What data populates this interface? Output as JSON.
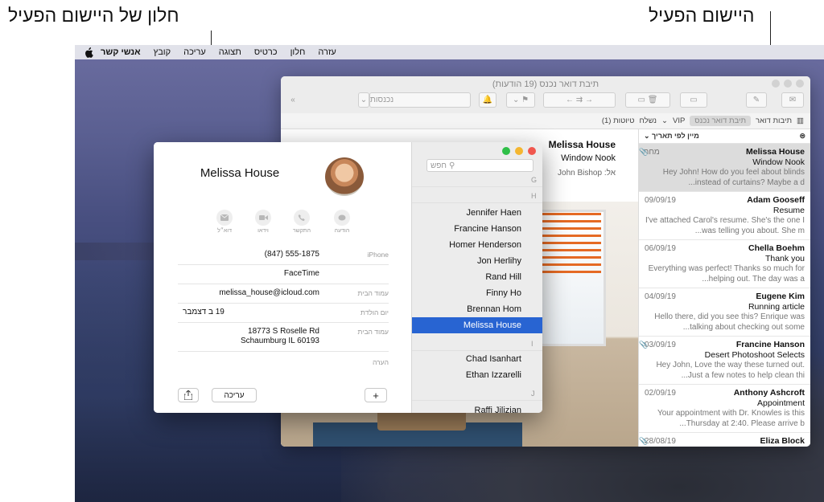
{
  "callouts": {
    "active_window": "חלון של היישום הפעיל",
    "active_app": "היישום הפעיל"
  },
  "menubar": {
    "items": [
      "אנשי קשר",
      "קובץ",
      "עריכה",
      "תצוגה",
      "כרטיס",
      "חלון",
      "עזרה"
    ]
  },
  "mail": {
    "title": "תיבת דואר נכנס (19 הודעות)",
    "search_placeholder": "נכנסות",
    "favorites": {
      "mailboxes": "תיבות דואר",
      "inbox": "תיבת דואר נכנס",
      "vip": "VIP",
      "sent": "נשלח",
      "drafts": "טיוטות (1)"
    },
    "sort_label": "מיין לפי תאריך",
    "open_message": {
      "from": "Melissa House",
      "subject": "Window Nook",
      "to_label": "אל:",
      "to": "John Bishop"
    },
    "messages": [
      {
        "from": "Melissa House",
        "date": "מחר",
        "subject": "Window Nook",
        "preview": "Hey John! How do you feel about blinds instead of curtains? Maybe a d...",
        "clip": true
      },
      {
        "from": "Adam Gooseff",
        "date": "09/09/19",
        "subject": "Resume",
        "preview": "I've attached Carol's resume. She's the one I was telling you about. She m...",
        "clip": false
      },
      {
        "from": "Chella Boehm",
        "date": "06/09/19",
        "subject": "Thank you",
        "preview": "Everything was perfect! Thanks so much for helping out. The day was a...",
        "clip": false
      },
      {
        "from": "Eugene Kim",
        "date": "04/09/19",
        "subject": "Running article",
        "preview": "Hello there, did you see this? Enrique was talking about checking out some...",
        "clip": false
      },
      {
        "from": "Francine Hanson",
        "date": "03/09/19",
        "subject": "Desert Photoshoot Selects",
        "preview": "Hey John, Love the way these turned out. Just a few notes to help clean thi...",
        "clip": true
      },
      {
        "from": "Anthony Ashcroft",
        "date": "02/09/19",
        "subject": "Appointment",
        "preview": "Your appointment with Dr. Knowles is this Thursday at 2:40. Please arrive b...",
        "clip": false
      },
      {
        "from": "Eliza Block",
        "date": "28/08/19",
        "subject": "",
        "preview": "",
        "clip": true
      }
    ]
  },
  "contacts": {
    "search_placeholder": "חפש",
    "card": {
      "name": "Melissa House",
      "actions": {
        "message": "הודעה",
        "call": "התקשר",
        "video": "וידאו",
        "mail": "דוא״ל"
      },
      "fields": [
        {
          "label": "iPhone",
          "value": "(847) 555-1875"
        },
        {
          "label": "",
          "value": "FaceTime"
        },
        {
          "label": "עמוד הבית",
          "value": "melissa_house@icloud.com"
        },
        {
          "label": "יום הולדת",
          "value": "19 ב דצמבר"
        },
        {
          "label": "עמוד הבית",
          "value": "18773 S Roselle Rd\nSchaumburg IL 60193"
        },
        {
          "label": "הערה",
          "value": ""
        }
      ],
      "edit_label": "עריכה",
      "add_label": "+"
    },
    "sections": {
      "g": "G",
      "h": "H",
      "i": "I",
      "j": "J"
    },
    "names_h": [
      "Jennifer Haen",
      "Francine Hanson",
      "Homer Henderson",
      "Jon Herlihy",
      "Rand Hill",
      "Finny Ho",
      "Brennan Hom",
      "Melissa House"
    ],
    "names_i": [
      "Chad Isanhart",
      "Ethan Izzarelli"
    ],
    "names_j": [
      "Raffi Jilizian"
    ]
  }
}
